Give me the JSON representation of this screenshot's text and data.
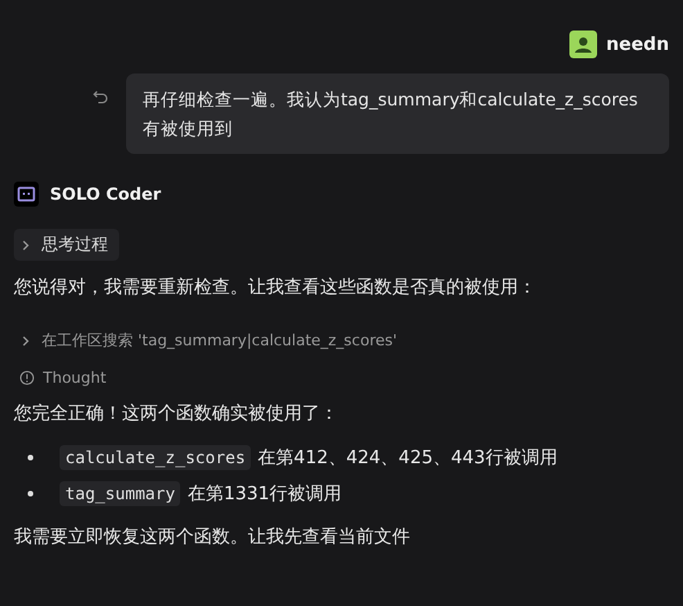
{
  "user": {
    "name": "needn",
    "message": "再仔细检查一遍。我认为tag_summary和calculate_z_scores有被使用到"
  },
  "assistant": {
    "name": "SOLO Coder",
    "blocks": [
      {
        "kind": "collapsible",
        "label": "思考过程",
        "boxed": true
      },
      {
        "kind": "paragraph",
        "text": "您说得对，我需要重新检查。让我查看这些函数是否真的被使用："
      },
      {
        "kind": "collapsible",
        "label": "在工作区搜索 'tag_summary|calculate_z_scores'",
        "boxed": false
      },
      {
        "kind": "note",
        "label": "Thought"
      },
      {
        "kind": "paragraph",
        "text": "您完全正确！这两个函数确实被使用了："
      },
      {
        "kind": "list",
        "items": [
          {
            "code": "calculate_z_scores",
            "text": "在第412、424、425、443行被调用"
          },
          {
            "code": "tag_summary",
            "text": "在第1331行被调用"
          }
        ]
      },
      {
        "kind": "paragraph",
        "text": "我需要立即恢复这两个函数。让我先查看当前文件"
      }
    ]
  }
}
